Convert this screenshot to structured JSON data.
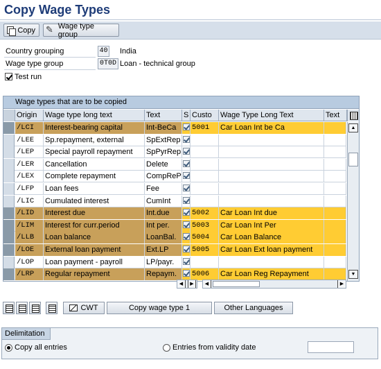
{
  "title": "Copy Wage Types",
  "toolbar": {
    "copy_label": "Copy",
    "group_label": "Wage type group"
  },
  "fields": {
    "country_grouping": {
      "label": "Country grouping",
      "value": "40",
      "desc": "India"
    },
    "wage_type_group": {
      "label": "Wage type group",
      "value": "0T0D",
      "desc": "Loan - technical group"
    },
    "test_run": {
      "label": "Test run",
      "checked": true
    }
  },
  "table": {
    "title": "Wage types that are to be copied",
    "headers": [
      "Origin",
      "Wage type long text",
      "Text",
      "S",
      "Custo",
      "Wage Type Long Text",
      "Text"
    ],
    "rows": [
      {
        "origin": "/LCI",
        "long": "Interest-bearing capital",
        "text": "Int-BeCa",
        "s": true,
        "cust": "5001",
        "ctext": "Car Loan Int be Ca",
        "hl": true
      },
      {
        "origin": "/LEE",
        "long": "Sp.repayment, external",
        "text": "SpExtRep",
        "s": true,
        "cust": "",
        "ctext": "",
        "hl": false
      },
      {
        "origin": "/LEP",
        "long": "Special payroll repayment",
        "text": "SpPyrRep",
        "s": true,
        "cust": "",
        "ctext": "",
        "hl": false
      },
      {
        "origin": "/LER",
        "long": "Cancellation",
        "text": "Delete",
        "s": true,
        "cust": "",
        "ctext": "",
        "hl": false
      },
      {
        "origin": "/LEX",
        "long": "Complete repayment",
        "text": "CompRePy",
        "s": true,
        "cust": "",
        "ctext": "",
        "hl": false
      },
      {
        "origin": "/LFP",
        "long": "Loan fees",
        "text": "Fee",
        "s": true,
        "cust": "",
        "ctext": "",
        "hl": false
      },
      {
        "origin": "/LIC",
        "long": "Cumulated interest",
        "text": "CumInt",
        "s": true,
        "cust": "",
        "ctext": "",
        "hl": false
      },
      {
        "origin": "/LID",
        "long": "Interest due",
        "text": "Int.due",
        "s": true,
        "cust": "5002",
        "ctext": "Car Loan Int due",
        "hl": true
      },
      {
        "origin": "/LIM",
        "long": "Interest for curr.period",
        "text": "Int per.",
        "s": true,
        "cust": "5003",
        "ctext": "Car Loan Int Per",
        "hl": true
      },
      {
        "origin": "/LLB",
        "long": "Loan balance",
        "text": "LoanBal.",
        "s": true,
        "cust": "5004",
        "ctext": "Car Loan Balance",
        "hl": true
      },
      {
        "origin": "/LOE",
        "long": "External loan payment",
        "text": "Ext.LP",
        "s": true,
        "cust": "5005",
        "ctext": "Car Loan Ext loan payment",
        "hl": true
      },
      {
        "origin": "/LOP",
        "long": "Loan payment - payroll",
        "text": "LP/payr.",
        "s": true,
        "cust": "",
        "ctext": "",
        "hl": false
      },
      {
        "origin": "/LRP",
        "long": "Regular repayment",
        "text": "Repaym.",
        "s": true,
        "cust": "5006",
        "ctext": "Car Loan Reg Repayment",
        "hl": true
      }
    ]
  },
  "buttons": {
    "cwt": "CWT",
    "copy_one": "Copy wage type 1",
    "other_lang": "Other Languages"
  },
  "delimitation": {
    "title": "Delimitation",
    "copy_all": "Copy all entries",
    "from_date": "Entries from validity date",
    "selected": "copy_all"
  },
  "colors": {
    "title": "#1e3c78",
    "highlight_left": "#c8a05a",
    "highlight_right": "#ffcc33",
    "toolbar": "#d6dfea"
  }
}
